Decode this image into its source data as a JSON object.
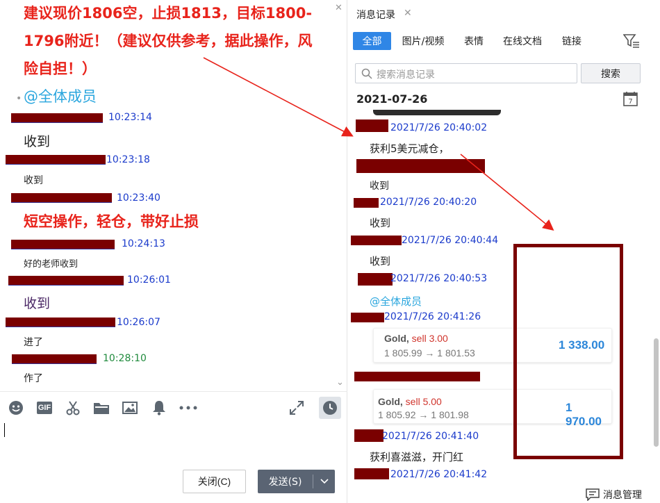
{
  "left": {
    "announcement": [
      "建议现价1806空，止损1813，目标1800-",
      "1796附近！（建议仅供参考，据此操作，风",
      "险自担！）"
    ],
    "mention": "@全体成员",
    "messages": [
      {
        "time": "10:23:14",
        "text": "收到"
      },
      {
        "time": "10:23:18",
        "text": "收到"
      },
      {
        "time": "10:23:40",
        "text": "短空操作，轻仓，带好止损"
      },
      {
        "time": "10:24:13",
        "text": "好的老师收到"
      },
      {
        "time": "10:26:01",
        "text": "收到"
      },
      {
        "time": "10:26:07",
        "text": "进了"
      },
      {
        "time": "10:28:10",
        "text": "作了"
      }
    ],
    "buttons": {
      "close": "关闭(C)",
      "send": "发送(S)"
    },
    "toolbar_icons": [
      "emoji-icon",
      "gif-icon",
      "scissors-icon",
      "folder-icon",
      "image-icon",
      "bell-icon",
      "more-icon",
      "expand-icon",
      "history-clock-icon"
    ],
    "gif_label": "GIF"
  },
  "right": {
    "tab_title": "消息记录",
    "filters": [
      "全部",
      "图片/视频",
      "表情",
      "在线文档",
      "链接"
    ],
    "active_filter": "全部",
    "search_placeholder": "搜索消息记录",
    "search_button": "搜索",
    "date_header": "2021-07-26",
    "calendar_day": "7",
    "entries": [
      {
        "time": "2021/7/26 20:40:02",
        "text": "获利5美元减仓，"
      },
      {
        "time": "",
        "text": "收到"
      },
      {
        "time": "2021/7/26 20:40:20",
        "text": "收到"
      },
      {
        "time": "2021/7/26 20:40:44",
        "text": "收到"
      },
      {
        "time": "2021/7/26 20:40:53",
        "text": "@全体成员"
      },
      {
        "time": "2021/7/26 20:41:26",
        "text": ""
      },
      {
        "time": "2021/7/26 20:41:40",
        "text": "获利喜滋滋，开门红"
      },
      {
        "time": "2021/7/26 20:41:42",
        "text": ""
      }
    ],
    "cards": [
      {
        "symbol": "Gold,",
        "side": "sell 3.00",
        "prices": "1 805.99 → 1 801.53",
        "value": "1 338.00"
      },
      {
        "symbol": "Gold,",
        "side": "sell 5.00",
        "prices": "1 805.92 → 1 801.98",
        "value": "1 970.00"
      }
    ],
    "manage_label": "消息管理"
  },
  "colors": {
    "accent": "#2f86e6",
    "announcement_red": "#e8231b",
    "timestamp_blue": "#1a3acb",
    "mention_blue": "#2aa6de",
    "annotation": "#e8231b",
    "redact": "#7a0000"
  }
}
